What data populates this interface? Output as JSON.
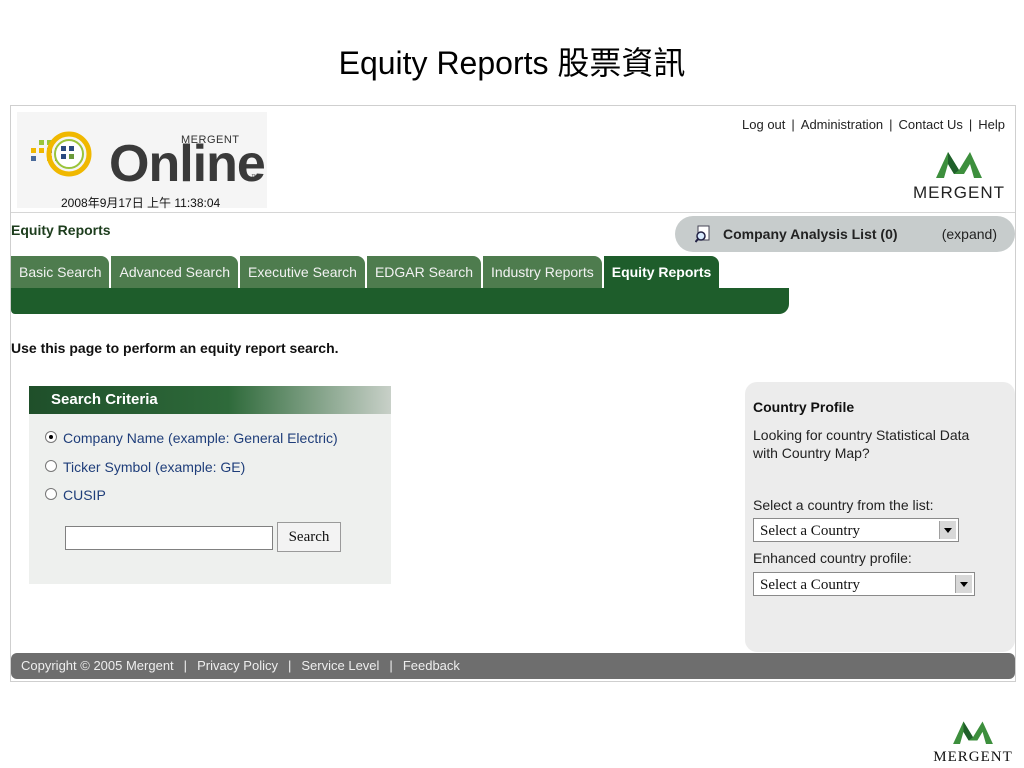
{
  "slide": {
    "title": "Equity Reports  股票資訊"
  },
  "header": {
    "logo": {
      "brand": "MERGENT",
      "product": "Online",
      "tm": "™"
    },
    "datetime": "2008年9月17日 上午 11:38:04",
    "links": [
      "Log out",
      "Administration",
      "Contact Us",
      "Help"
    ],
    "right_logo_word": "MERGENT"
  },
  "section_label": "Equity Reports",
  "analysis_list": {
    "label": "Company Analysis List (0)",
    "expand": "(expand)"
  },
  "tabs": [
    {
      "label": "Basic Search",
      "active": false
    },
    {
      "label": "Advanced Search",
      "active": false
    },
    {
      "label": "Executive Search",
      "active": false
    },
    {
      "label": "EDGAR Search",
      "active": false
    },
    {
      "label": "Industry Reports",
      "active": false
    },
    {
      "label": "Equity Reports",
      "active": true
    }
  ],
  "intro": "Use this page to perform an equity report search.",
  "search_criteria": {
    "title": "Search Criteria",
    "options": [
      {
        "label": "Company Name (example: General Electric)",
        "selected": true
      },
      {
        "label": "Ticker Symbol (example: GE)",
        "selected": false
      },
      {
        "label": "CUSIP",
        "selected": false
      }
    ],
    "input_value": "",
    "button": "Search"
  },
  "country_profile": {
    "title": "Country Profile",
    "description": "Looking for country Statistical Data with Country Map?",
    "select_label": "Select a country from the list:",
    "select_value": "Select a Country",
    "enhanced_label": "Enhanced country profile:",
    "enhanced_value": "Select a Country"
  },
  "footer": [
    "Copyright © 2005 Mergent",
    "Privacy Policy",
    "Service Level",
    "Feedback"
  ],
  "corner_logo": "MERGENT",
  "colors": {
    "tab_green": "#4e7c4e",
    "active_green": "#1e5d2b",
    "footer_gray": "#6e6e6e"
  }
}
